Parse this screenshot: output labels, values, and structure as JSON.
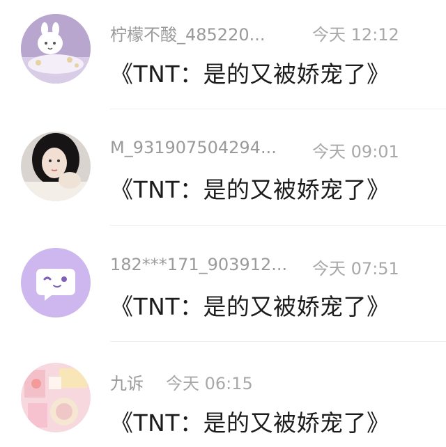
{
  "conversations": [
    {
      "name": "柠檬不酸_485220...",
      "time": "今天 12:12",
      "message": "《TNT：是的又被娇宠了》",
      "avatar_icon": "cartoon-bunny-bath-avatar"
    },
    {
      "name": "M_931907504294...",
      "time": "今天 09:01",
      "message": "《TNT：是的又被娇宠了》",
      "avatar_icon": "girl-portrait-avatar"
    },
    {
      "name": "182***171_903912...",
      "time": "今天 07:51",
      "message": "《TNT：是的又被娇宠了》",
      "avatar_icon": "chat-bubble-face-avatar"
    },
    {
      "name": "九诉",
      "time": "今天 06:15",
      "message": "《TNT：是的又被娇宠了》",
      "avatar_icon": "pink-collage-avatar"
    }
  ],
  "colors": {
    "name_text": "#9a9a9a",
    "time_text": "#a8a8a8",
    "message_text": "#1c1c1c",
    "divider": "#ededed",
    "avatar_purple": "#cdb7ee"
  }
}
